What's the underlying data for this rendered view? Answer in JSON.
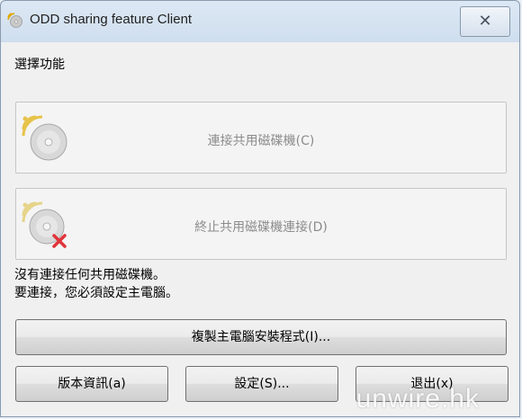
{
  "window": {
    "title": "ODD sharing feature Client",
    "close_glyph": "✕"
  },
  "section_label": "選擇功能",
  "actions": {
    "connect": {
      "label": "連接共用磁碟機(C)",
      "icon": "cd-disc-wireless-icon"
    },
    "disconnect": {
      "label": "終止共用磁碟機連接(D)",
      "icon": "cd-disc-disconnect-icon"
    }
  },
  "status": {
    "line1": "沒有連接任何共用磁碟機。",
    "line2": "要連接，您必須設定主電腦。"
  },
  "buttons": {
    "copy_installer": "複製主電腦安裝程式(I)...",
    "version_info": "版本資訊(a)",
    "settings": "設定(S)...",
    "exit": "退出(x)"
  },
  "watermark": "unwire.hk",
  "colors": {
    "disabled_text": "#8c8c8c",
    "disconnect_x": "#e0343a",
    "signal_yellow": "#f2c200"
  }
}
